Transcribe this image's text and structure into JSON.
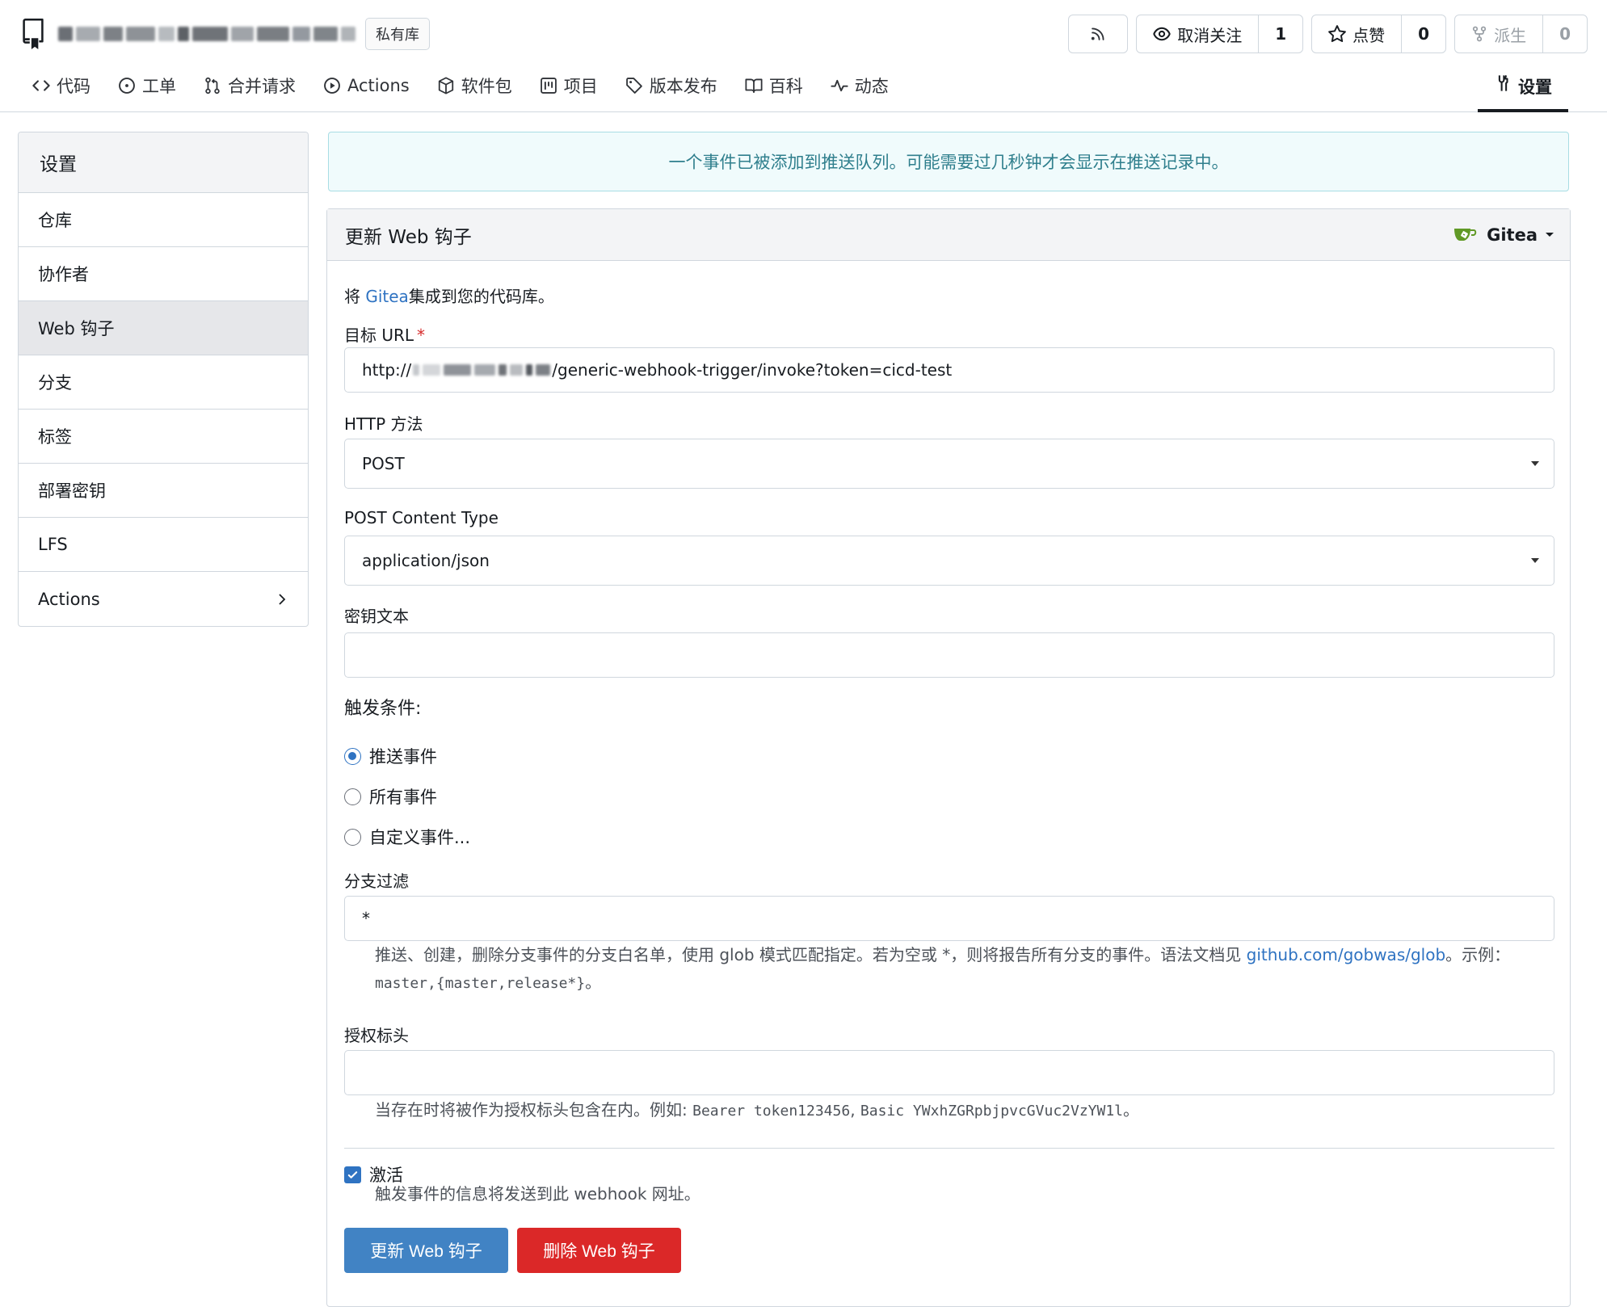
{
  "header": {
    "private_badge": "私有库",
    "rss_icon": "rss-icon",
    "watch": {
      "label": "取消关注",
      "count": "1"
    },
    "star": {
      "label": "点赞",
      "count": "0"
    },
    "fork": {
      "label": "派生",
      "count": "0"
    }
  },
  "tabs": [
    {
      "label": "代码",
      "icon": "code-icon"
    },
    {
      "label": "工单",
      "icon": "issue-icon"
    },
    {
      "label": "合并请求",
      "icon": "pull-request-icon"
    },
    {
      "label": "Actions",
      "icon": "play-icon"
    },
    {
      "label": "软件包",
      "icon": "package-icon"
    },
    {
      "label": "项目",
      "icon": "project-icon"
    },
    {
      "label": "版本发布",
      "icon": "tag-icon"
    },
    {
      "label": "百科",
      "icon": "book-icon"
    },
    {
      "label": "动态",
      "icon": "pulse-icon"
    }
  ],
  "settings_tab": "设置",
  "sidebar": {
    "title": "设置",
    "items": [
      {
        "label": "仓库"
      },
      {
        "label": "协作者"
      },
      {
        "label": "Web 钩子"
      },
      {
        "label": "分支"
      },
      {
        "label": "标签"
      },
      {
        "label": "部署密钥"
      },
      {
        "label": "LFS"
      },
      {
        "label": "Actions"
      }
    ],
    "active_index": 2
  },
  "flash": "一个事件已被添加到推送队列。可能需要过几秒钟才会显示在推送记录中。",
  "panel": {
    "title": "更新 Web 钩子",
    "type_selector": "Gitea",
    "intro_prefix": "将 ",
    "intro_link": "Gitea",
    "intro_suffix": "集成到您的代码库。"
  },
  "form": {
    "target_url_label": "目标 URL",
    "target_url_prefix": "http://",
    "target_url_suffix": "/generic-webhook-trigger/invoke?token=cicd-test",
    "http_method_label": "HTTP 方法",
    "http_method_value": "POST",
    "content_type_label": "POST Content Type",
    "content_type_value": "application/json",
    "secret_label": "密钥文本",
    "secret_value": "",
    "trigger_title": "触发条件:",
    "trigger_options": [
      {
        "label": "推送事件",
        "checked": true
      },
      {
        "label": "所有事件",
        "checked": false
      },
      {
        "label": "自定义事件...",
        "checked": false
      }
    ],
    "branch_filter_label": "分支过滤",
    "branch_filter_value": "*",
    "branch_help_1": "推送、创建，删除分支事件的分支白名单，使用 glob 模式匹配指定。若为空或 *，则将报告所有分支的事件。语法文档见 ",
    "branch_help_link": "github.com/gobwas/glob",
    "branch_help_2": "。示例：",
    "branch_help_example": "master,{master,release*}",
    "branch_help_end": "。",
    "auth_header_label": "授权标头",
    "auth_header_value": "",
    "auth_help_1": "当存在时将被作为授权标头包含在内。例如: ",
    "auth_help_ex1": "Bearer token123456",
    "auth_help_sep": ", ",
    "auth_help_ex2": "Basic YWxhZGRpbjpvcGVuc2VzYW1l",
    "auth_help_end": "。",
    "active_label": "激活",
    "active_checked": true,
    "active_help": "触发事件的信息将发送到此 webhook 网址。",
    "update_button": "更新 Web 钩子",
    "delete_button": "删除 Web 钩子"
  },
  "colors": {
    "primary": "#4183c4",
    "danger": "#db2828",
    "link": "#2f73c2",
    "flash_text": "#2f7f8d",
    "flash_bg": "#f0fbfc",
    "gitea_green": "#609926"
  }
}
